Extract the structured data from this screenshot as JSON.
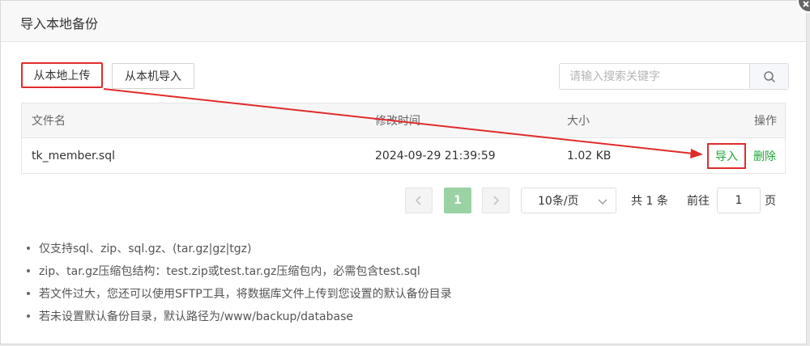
{
  "dialog": {
    "title": "导入本地备份"
  },
  "toolbar": {
    "upload_local_label": "从本地上传",
    "import_local_label": "从本机导入",
    "search_placeholder": "请输入搜索关键字"
  },
  "table": {
    "headers": {
      "name": "文件名",
      "mtime": "修改时间",
      "size": "大小",
      "ops": "操作"
    },
    "rows": [
      {
        "name": "tk_member.sql",
        "mtime": "2024-09-29 21:39:59",
        "size": "1.02 KB",
        "import_label": "导入",
        "delete_label": "删除"
      }
    ]
  },
  "pagination": {
    "current_page": "1",
    "page_size_label": "10条/页",
    "total_label": "共 1 条",
    "goto_label": "前往",
    "goto_value": "1",
    "page_suffix": "页"
  },
  "notes": [
    "仅支持sql、zip、sql.gz、(tar.gz|gz|tgz)",
    "zip、tar.gz压缩包结构：test.zip或test.tar.gz压缩包内，必需包含test.sql",
    "若文件过大，您还可以使用SFTP工具，将数据库文件上传到您设置的默认备份目录",
    "若未设置默认备份目录，默认路径为/www/backup/database"
  ],
  "colors": {
    "accent": "#20a53a",
    "annotation": "#e02b2b",
    "current_page_bg": "#9ad2a4"
  },
  "icons": [
    "close-icon",
    "search-icon",
    "chevron-left-icon",
    "chevron-right-icon",
    "chevron-down-icon"
  ]
}
